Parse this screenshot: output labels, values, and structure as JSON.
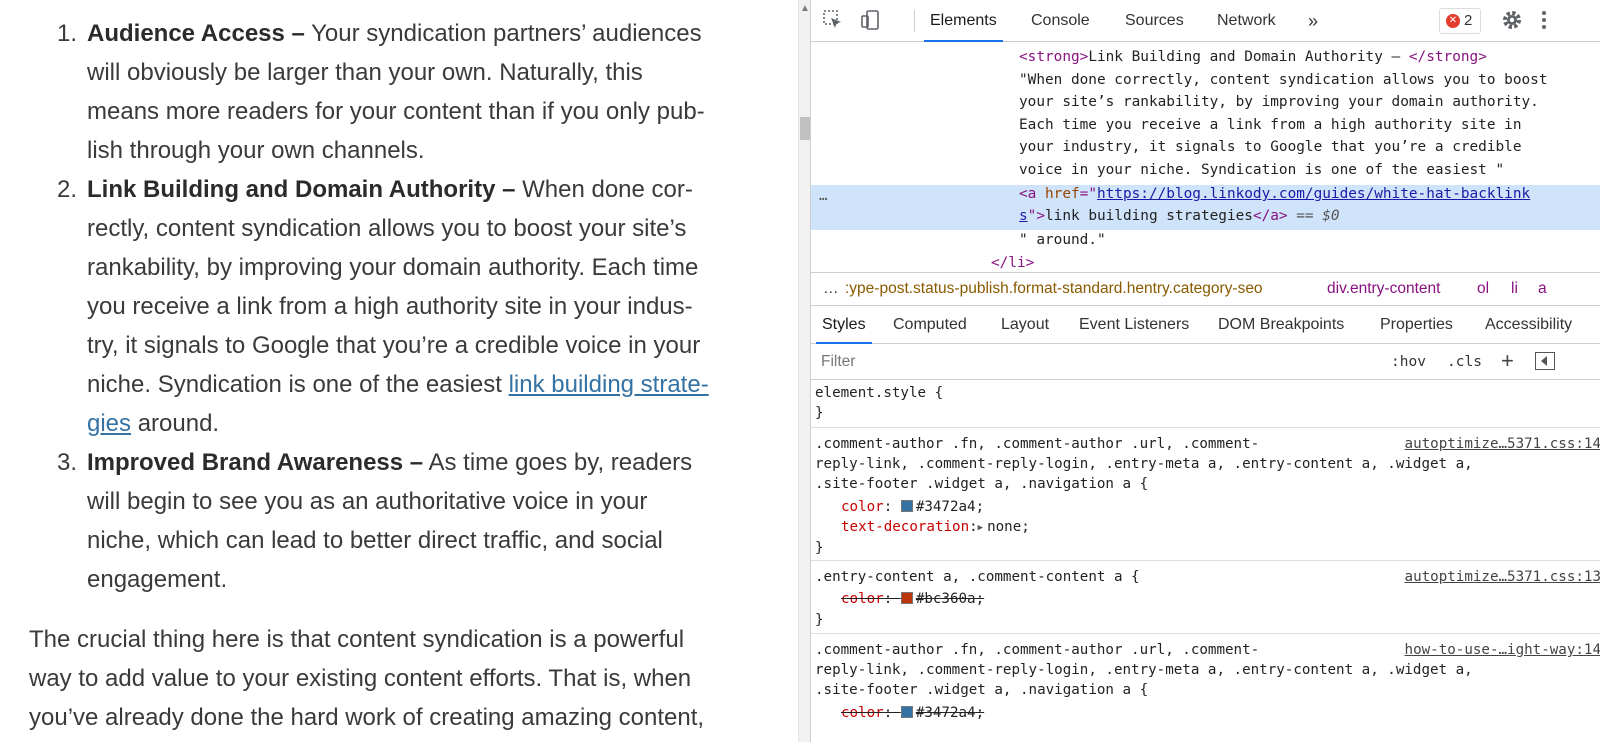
{
  "article": {
    "items": [
      {
        "num": "1.",
        "heading": "Audience Access –",
        "lines": [
          " Your syndication partners’ audiences",
          "will obviously be larger than your own. Naturally, this",
          "means more readers for your content than if you only pub-",
          "lish through your own channels."
        ]
      },
      {
        "num": "2.",
        "heading": "Link Building and Domain Authority –",
        "lines": [
          " When done cor-",
          "rectly, content syndication allows you to boost your site’s",
          "rankability, by improving your domain authority. Each time",
          "you receive a link from a high authority site in your indus-",
          "try, it signals to Google that you’re a credible voice in your"
        ],
        "line6_before": "niche. Syndication is one of the easiest ",
        "link_part1": "link building strate-",
        "link_part2": "gies",
        "after_link": " around."
      },
      {
        "num": "3.",
        "heading": "Improved Brand Awareness –",
        "lines": [
          " As time goes by, readers",
          "will begin to see you as an authoritative voice in your",
          "niche, which can lead to better direct traffic, and social",
          "engagement."
        ]
      }
    ],
    "paragraph_lines": [
      "The crucial thing here is that content syndication is a powerful",
      "way to add value to your existing content efforts. That is, when",
      "you’ve already done the hard work of creating amazing content,"
    ]
  },
  "devtools": {
    "tabs": [
      "Elements",
      "Console",
      "Sources",
      "Network"
    ],
    "more_tabs": "»",
    "error_count": "2",
    "dom": {
      "strong_open": "<strong>",
      "strong_text": "Link Building and Domain Authority – ",
      "strong_close": "</strong>",
      "text_lines": [
        "\"When done correctly, content syndication allows you to boost",
        "your site’s rankability, by improving your domain authority.",
        "Each time you receive a link from a high authority site in",
        "your industry, it signals to Google that you’re a credible",
        "voice in your niche. Syndication is one of the easiest \""
      ],
      "a_open": "<a ",
      "href_attr": "href",
      "href_eq": "=\"",
      "href_val1": "https://blog.linkody.com/guides/white-hat-backlink",
      "href_val2": "s",
      "a_close_quote": "\">",
      "a_text": "link building strategies",
      "a_close": "</a>",
      "eq0": " == $0",
      "after_text": "\" around.\"",
      "li_close": "</li>",
      "selected_dots": "…"
    },
    "breadcrumb": {
      "more": "…",
      "items": [
        ":ype-post.status-publish.format-standard.hentry.category-seo",
        "div.entry-content",
        "ol",
        "li",
        "a"
      ]
    },
    "subtabs": [
      "Styles",
      "Computed",
      "Layout",
      "Event Listeners",
      "DOM Breakpoints",
      "Properties",
      "Accessibility"
    ],
    "filter_placeholder": "Filter",
    "hov": ":hov",
    "cls": ".cls",
    "plus": "+",
    "rules": [
      {
        "lines": [
          "element.style {",
          "}"
        ]
      },
      {
        "selector_lines": [
          ".comment-author .fn, .comment-author .url, .comment-",
          "reply-link, .comment-reply-login, .entry-meta a, .entry-content a, .widget a,",
          ".site-footer .widget a, .navigation a {"
        ],
        "source": "autoptimize…5371.css:14",
        "props": [
          {
            "name": "color",
            "value": "#3472a4",
            "swatch": "#3472a4",
            "strike": false
          },
          {
            "name": "text-decoration",
            "value": "none",
            "strike": false,
            "expander": "▶"
          }
        ],
        "close": "}"
      },
      {
        "selector_lines": [
          ".entry-content a, .comment-content a {"
        ],
        "source": "autoptimize…5371.css:13",
        "props": [
          {
            "name": "color",
            "value": "#bc360a",
            "swatch": "#bc360a",
            "strike": true
          }
        ],
        "close": "}"
      },
      {
        "selector_lines": [
          ".comment-author .fn, .comment-author .url, .comment-",
          "reply-link, .comment-reply-login, .entry-meta a, .entry-content a, .widget a,",
          ".site-footer .widget a, .navigation a {"
        ],
        "source": "how-to-use-…ight-way:14",
        "props": [
          {
            "name": "color",
            "value": "#3472a4",
            "swatch": "#3472a4",
            "strike": true
          }
        ]
      }
    ]
  }
}
